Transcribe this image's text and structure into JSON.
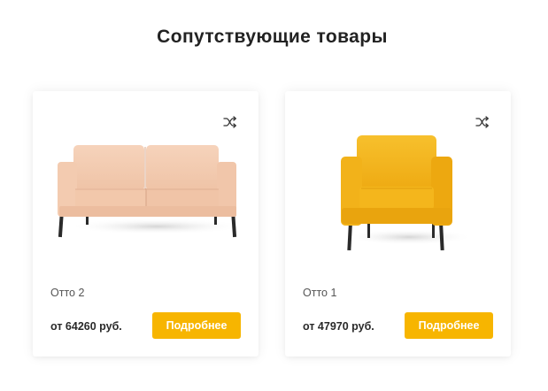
{
  "section": {
    "title": "Сопутствующие товары"
  },
  "products": [
    {
      "name": "Отто 2",
      "price": "от 64260 руб.",
      "button_label": "Подробнее",
      "image": "peach-two-seat-sofa",
      "compare_icon": "shuffle-icon",
      "color": "#f3c9ad"
    },
    {
      "name": "Отто 1",
      "price": "от 47970 руб.",
      "button_label": "Подробнее",
      "image": "yellow-armchair",
      "compare_icon": "shuffle-icon",
      "color": "#f2b118"
    }
  ],
  "colors": {
    "accent": "#f7b500",
    "title": "#222222",
    "muted_text": "#555555"
  }
}
